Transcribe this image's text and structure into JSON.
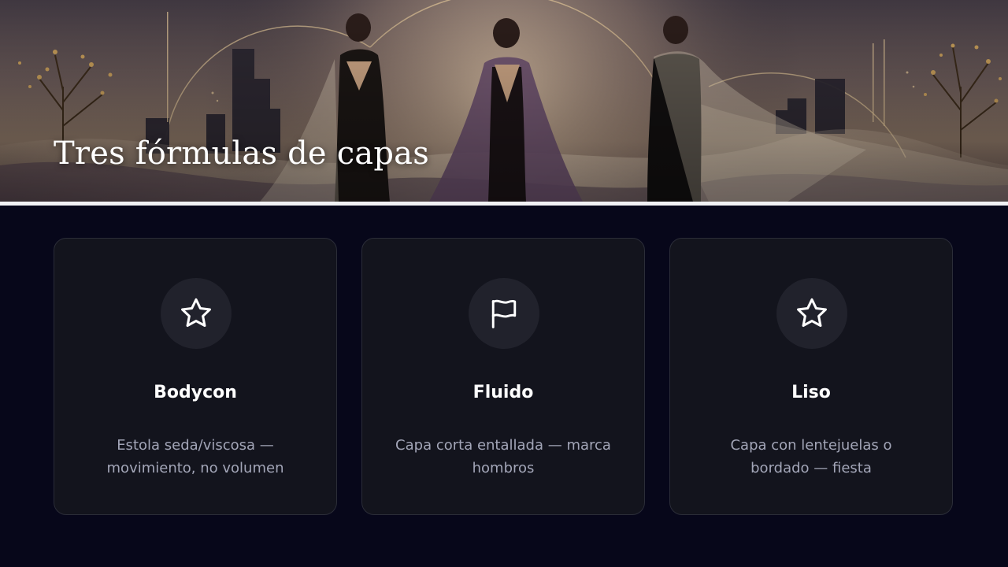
{
  "hero": {
    "title": "Tres fórmulas de capas"
  },
  "cards": [
    {
      "icon": "star-icon",
      "title": "Bodycon",
      "description": "Estola seda/viscosa — movimiento, no volumen"
    },
    {
      "icon": "flag-icon",
      "title": "Fluido",
      "description": "Capa corta entallada — marca hombros"
    },
    {
      "icon": "star-icon",
      "title": "Liso",
      "description": "Capa con lentejuelas o bordado — fiesta"
    }
  ],
  "colors": {
    "background": "#07071a",
    "card": "#13141d",
    "card_border": "#2b2d38",
    "icon_circle": "#21222c",
    "title_text": "#ffffff",
    "body_text": "#a3a6b8"
  }
}
